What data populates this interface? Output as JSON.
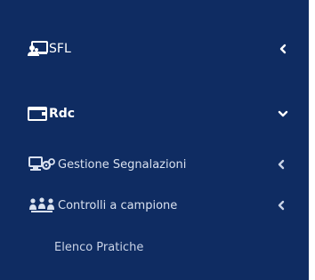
{
  "sidebar": {
    "items": [
      {
        "label": "SFL",
        "icon": "laptop-users-icon",
        "chevron": "chevron-left-icon",
        "expanded": false
      },
      {
        "label": "Rdc",
        "icon": "card-icon",
        "chevron": "chevron-down-icon",
        "expanded": true,
        "children": [
          {
            "label": "Gestione Segnalazioni",
            "icon": "screen-cogs-icon",
            "chevron": "chevron-left-icon"
          },
          {
            "label": "Controlli a campione",
            "icon": "people-group-icon",
            "chevron": "chevron-left-icon"
          }
        ]
      },
      {
        "label": "Elenco Pratiche"
      }
    ]
  },
  "colors": {
    "sidebar_background": "#0f2c62",
    "text_primary": "#ffffff",
    "text_secondary": "#d9e1ef"
  }
}
